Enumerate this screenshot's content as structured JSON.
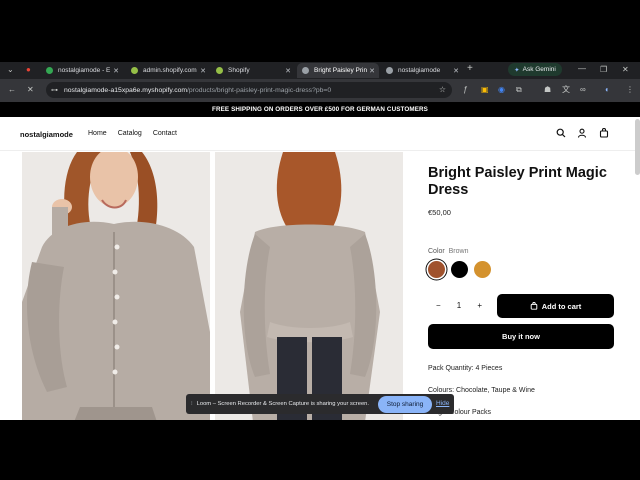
{
  "tabs": [
    {
      "label": "nostalgiamode - E",
      "color": "#34a853"
    },
    {
      "label": "admin.shopify.com",
      "color": "#95bf47"
    },
    {
      "label": "Shopify",
      "color": "#95bf47"
    },
    {
      "label": "Bright Paisley Prin",
      "color": "#9aa0a6"
    },
    {
      "label": "nostalgiamode",
      "color": "#9aa0a6"
    }
  ],
  "gemini_label": "Ask Gemini",
  "address": {
    "host": "nostalgiamode-a15xpa6e.myshopify.com",
    "path": "/products/bright-paisley-print-magic-dress?pb=0"
  },
  "promo": "FREE SHIPPING ON ORDERS OVER £500 FOR GERMAN CUSTOMERS",
  "store": {
    "logo": "nostalgiamode",
    "nav": [
      "Home",
      "Catalog",
      "Contact"
    ]
  },
  "product": {
    "title": "Bright Paisley Print Magic Dress",
    "price": "€50,00",
    "color_label": "Color",
    "color_value": "Brown",
    "swatches": [
      "#a0522d",
      "#000000",
      "#d4922e"
    ],
    "qty_minus": "−",
    "qty_value": "1",
    "qty_plus": "+",
    "add_to_cart": "Add to cart",
    "buy_now": "Buy it now",
    "desc1": "Pack Quantity: 4 Pieces",
    "desc2": "Colours: Chocolate, Taupe & Wine",
    "desc3": "Single Colour Packs"
  },
  "loom": {
    "message": "Loom – Screen Recorder & Screen Capture is sharing your screen.",
    "stop": "Stop sharing",
    "hide": "Hide"
  }
}
